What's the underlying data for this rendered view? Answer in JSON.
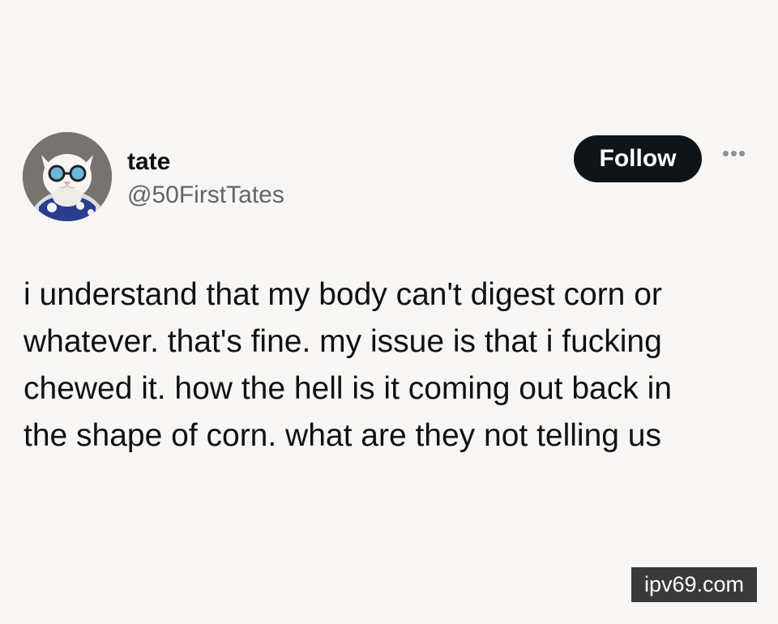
{
  "post": {
    "author": {
      "display_name": "tate",
      "handle": "@50FirstTates",
      "avatar_icon": "cat-with-sunglasses-avatar"
    },
    "actions": {
      "follow_label": "Follow",
      "more_icon": "more-horizontal-icon"
    },
    "body": "i understand that my body can't digest corn or\nwhatever. that's fine. my issue is that i fucking\nchewed it. how the hell is it coming out back in\nthe shape of corn. what are they not telling us"
  },
  "watermark": {
    "text": "ipv69.com"
  },
  "colors": {
    "background": "#f8f6f4",
    "text": "#111111",
    "secondary_text": "#5f656b",
    "button_background": "#0f1419",
    "button_text": "#ffffff",
    "watermark_background": "#3a3a3a"
  }
}
